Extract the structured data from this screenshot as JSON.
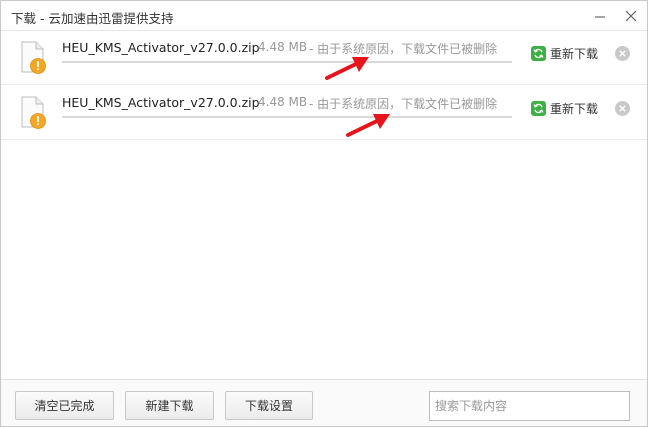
{
  "window": {
    "title": "下载 - 云加速由迅雷提供支持",
    "minimize_icon": "minimize-icon",
    "close_icon": "close-icon"
  },
  "downloads": [
    {
      "file_name": "HEU_KMS_Activator_v27.0.0.zip",
      "size": "4.48 MB",
      "status": "- 由于系统原因，下载文件已被删除",
      "retry_label": "重新下载",
      "progress": 0
    },
    {
      "file_name": "HEU_KMS_Activator_v27.0.0.zip",
      "size": "4.48 MB",
      "status": "- 由于系统原因，下载文件已被删除",
      "retry_label": "重新下载",
      "progress": 0
    }
  ],
  "footer": {
    "clear_completed": "清空已完成",
    "new_download": "新建下载",
    "download_settings": "下载设置",
    "search_placeholder": "搜索下载内容",
    "search_value": ""
  },
  "colors": {
    "retry_icon": "#3cb042",
    "warning_icon": "#f5a623",
    "annotation_arrow": "#e8141b"
  }
}
